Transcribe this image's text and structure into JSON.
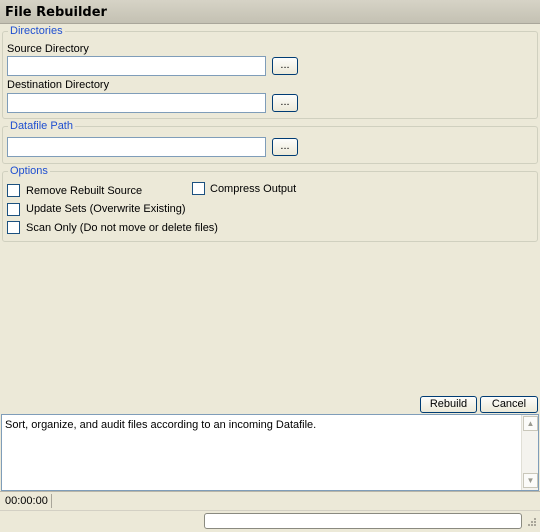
{
  "window": {
    "title": "File Rebuilder"
  },
  "directories": {
    "legend": "Directories",
    "source_label": "Source Directory",
    "source_value": "",
    "destination_label": "Destination Directory",
    "destination_value": "",
    "browse_label": "..."
  },
  "datafile": {
    "legend": "Datafile Path",
    "path_value": "",
    "browse_label": "..."
  },
  "options": {
    "legend": "Options",
    "remove_rebuilt_source": {
      "label": "Remove Rebuilt Source",
      "checked": false
    },
    "compress_output": {
      "label": "Compress Output",
      "checked": false
    },
    "update_sets": {
      "label": "Update Sets (Overwrite Existing)",
      "checked": false
    },
    "scan_only": {
      "label": "Scan Only (Do not move or delete files)",
      "checked": false
    }
  },
  "actions": {
    "rebuild_label": "Rebuild",
    "cancel_label": "Cancel"
  },
  "log": {
    "text": "Sort, organize, and audit files according to an incoming Datafile."
  },
  "status": {
    "time": "00:00:00"
  },
  "icons": {
    "scroll_up": "scroll-up-arrow-icon",
    "scroll_down": "scroll-down-arrow-icon",
    "resize_grip": "resize-grip-icon"
  }
}
